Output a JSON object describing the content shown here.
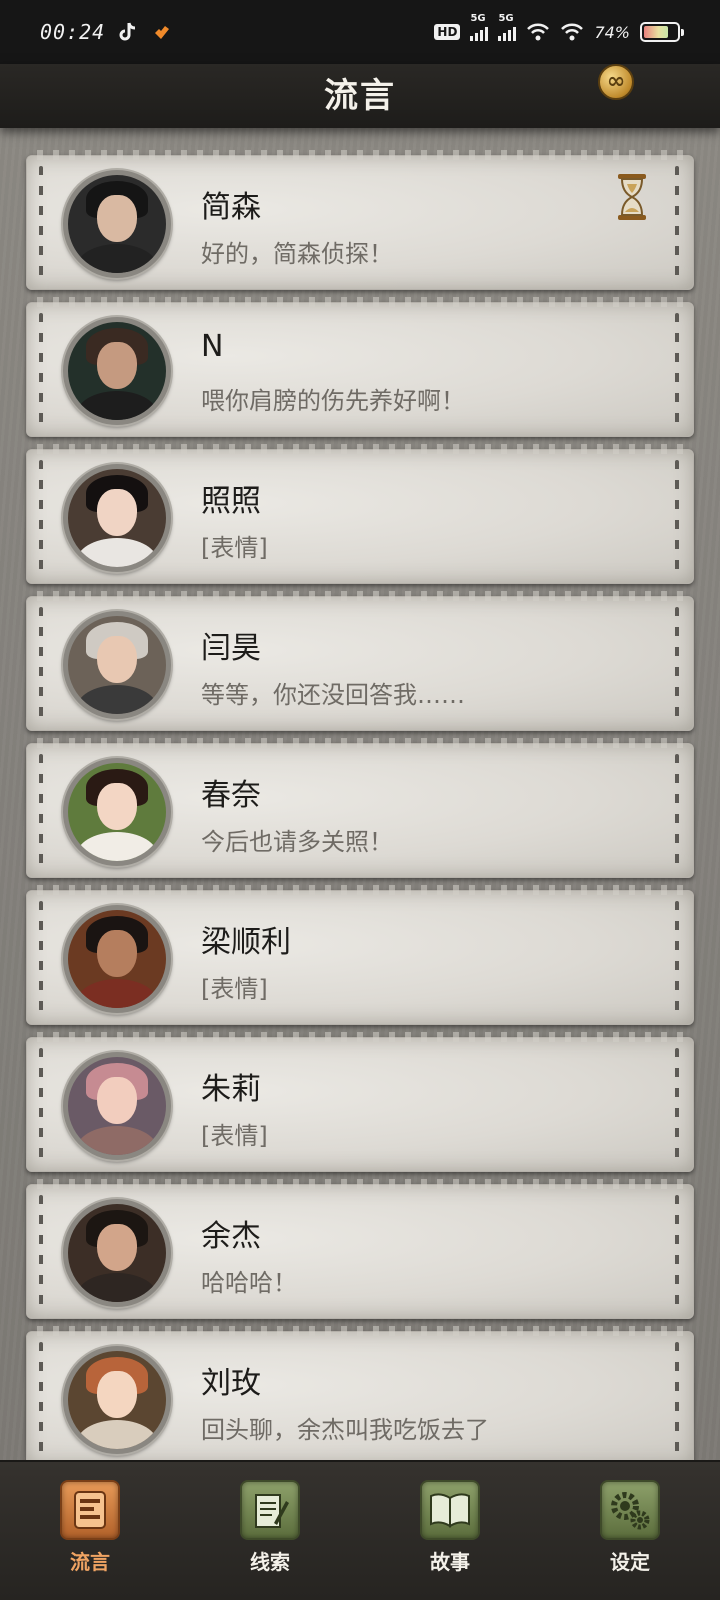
{
  "status_bar": {
    "time": "00:24",
    "hd": "HD",
    "signal1": "5G",
    "signal2": "5G",
    "battery": "74%",
    "battery_level": 0.74
  },
  "header": {
    "title": "流言",
    "coin_icon": "infinity-coin-icon"
  },
  "contacts": [
    {
      "name": "简森",
      "message": "好的，简森侦探！",
      "has_timer": true
    },
    {
      "name": "N",
      "message": "喂你肩膀的伤先养好啊！"
    },
    {
      "name": "照照",
      "message": "[表情]"
    },
    {
      "name": "闫昊",
      "message": "等等，你还没回答我……"
    },
    {
      "name": "春奈",
      "message": "今后也请多关照！"
    },
    {
      "name": "梁顺利",
      "message": "[表情]"
    },
    {
      "name": "朱莉",
      "message": "[表情]"
    },
    {
      "name": "余杰",
      "message": "哈哈哈！"
    },
    {
      "name": "刘玫",
      "message": "回头聊，余杰叫我吃饭去了"
    }
  ],
  "tabs": [
    {
      "label": "流言",
      "icon": "chat-list-icon",
      "active": true
    },
    {
      "label": "线索",
      "icon": "notepad-icon",
      "active": false
    },
    {
      "label": "故事",
      "icon": "book-icon",
      "active": false
    },
    {
      "label": "设定",
      "icon": "gears-icon",
      "active": false
    }
  ],
  "colors": {
    "active_tab": "#f0a463",
    "tab_icon_green": "#6e804a",
    "card_bg": "#dddad4"
  }
}
